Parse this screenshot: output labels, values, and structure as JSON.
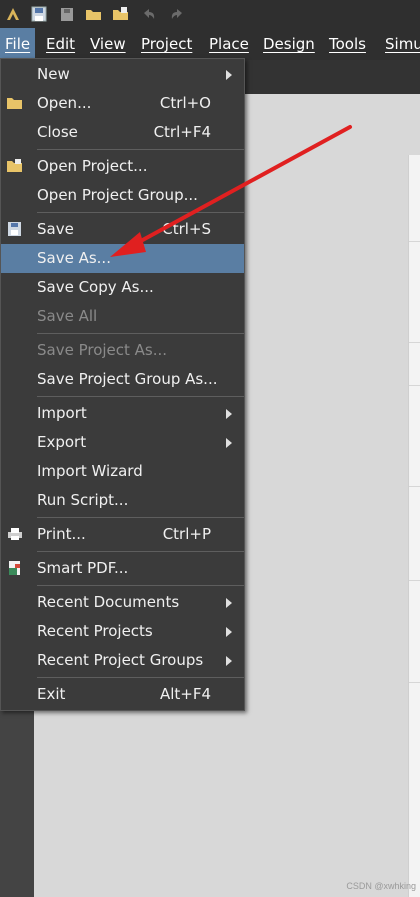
{
  "menubar": {
    "items": [
      {
        "label": "File"
      },
      {
        "label": "Edit"
      },
      {
        "label": "View"
      },
      {
        "label": "Project"
      },
      {
        "label": "Place"
      },
      {
        "label": "Design"
      },
      {
        "label": "Tools"
      },
      {
        "label": "Simu"
      }
    ]
  },
  "file_menu": {
    "items": [
      {
        "label": "New",
        "submenu": true
      },
      {
        "label": "Open...",
        "shortcut": "Ctrl+O",
        "icon": "open-folder-icon"
      },
      {
        "label": "Close",
        "shortcut": "Ctrl+F4"
      },
      {
        "label": "Open Project...",
        "icon": "open-project-icon"
      },
      {
        "label": "Open Project Group..."
      },
      {
        "label": "Save",
        "shortcut": "Ctrl+S",
        "icon": "save-icon"
      },
      {
        "label": "Save As...",
        "highlighted": true
      },
      {
        "label": "Save Copy As..."
      },
      {
        "label": "Save All",
        "disabled": true
      },
      {
        "label": "Save Project As...",
        "disabled": true
      },
      {
        "label": "Save Project Group As..."
      },
      {
        "label": "Import",
        "submenu": true
      },
      {
        "label": "Export",
        "submenu": true
      },
      {
        "label": "Import Wizard"
      },
      {
        "label": "Run Script..."
      },
      {
        "label": "Print...",
        "shortcut": "Ctrl+P",
        "icon": "print-icon"
      },
      {
        "label": "Smart PDF...",
        "icon": "pdf-icon"
      },
      {
        "label": "Recent Documents",
        "submenu": true
      },
      {
        "label": "Recent Projects",
        "submenu": true
      },
      {
        "label": "Recent Project Groups",
        "submenu": true
      },
      {
        "label": "Exit",
        "shortcut": "Alt+F4"
      }
    ]
  },
  "watermark": "CSDN @xwhking",
  "colors": {
    "highlight": "#5a7ea3",
    "annotation_arrow": "#e02020"
  }
}
